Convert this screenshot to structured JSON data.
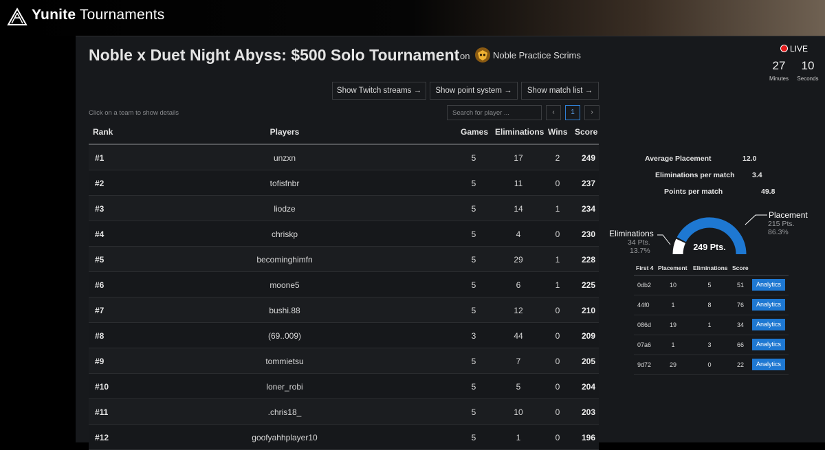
{
  "header": {
    "brand_bold": "Yunite",
    "brand_rest": " Tournaments"
  },
  "tournament": {
    "title": "Noble x Duet Night Abyss: $500 Solo Tournament",
    "on_text": "on",
    "org_name": "Noble Practice Scrims"
  },
  "live": {
    "label": "LIVE",
    "minutes": "27",
    "minutes_label": "Minutes",
    "seconds": "10",
    "seconds_label": "Seconds"
  },
  "toolbar": {
    "twitch": "Show Twitch streams",
    "points": "Show point system",
    "matches": "Show match list"
  },
  "hint": "Click on a team to show details",
  "search": {
    "placeholder": "Search for player ..."
  },
  "pagination": {
    "prev": "‹",
    "current": "1",
    "next": "›"
  },
  "table": {
    "headers": {
      "rank": "Rank",
      "players": "Players",
      "games": "Games",
      "elims": "Eliminations",
      "wins": "Wins",
      "score": "Score"
    },
    "rows": [
      {
        "rank": "#1",
        "player": "unzxn",
        "games": "5",
        "elims": "17",
        "wins": "2",
        "score": "249"
      },
      {
        "rank": "#2",
        "player": "tofisfnbr",
        "games": "5",
        "elims": "11",
        "wins": "0",
        "score": "237"
      },
      {
        "rank": "#3",
        "player": "liodze",
        "games": "5",
        "elims": "14",
        "wins": "1",
        "score": "234"
      },
      {
        "rank": "#4",
        "player": "chriskp",
        "games": "5",
        "elims": "4",
        "wins": "0",
        "score": "230"
      },
      {
        "rank": "#5",
        "player": "becominghimfn",
        "games": "5",
        "elims": "29",
        "wins": "1",
        "score": "228"
      },
      {
        "rank": "#6",
        "player": "moone5",
        "games": "5",
        "elims": "6",
        "wins": "1",
        "score": "225"
      },
      {
        "rank": "#7",
        "player": "bushi.88",
        "games": "5",
        "elims": "12",
        "wins": "0",
        "score": "210"
      },
      {
        "rank": "#8",
        "player": "(69..009)",
        "games": "3",
        "elims": "44",
        "wins": "0",
        "score": "209"
      },
      {
        "rank": "#9",
        "player": "tommietsu",
        "games": "5",
        "elims": "7",
        "wins": "0",
        "score": "205"
      },
      {
        "rank": "#10",
        "player": "loner_robi",
        "games": "5",
        "elims": "5",
        "wins": "0",
        "score": "204"
      },
      {
        "rank": "#11",
        "player": ".chris18_",
        "games": "5",
        "elims": "10",
        "wins": "0",
        "score": "203"
      },
      {
        "rank": "#12",
        "player": "goofyahhplayer10",
        "games": "5",
        "elims": "1",
        "wins": "0",
        "score": "196"
      }
    ]
  },
  "details": {
    "avg_placement_label": "Average Placement",
    "avg_placement": "12.0",
    "elims_per_match_label": "Eliminations per match",
    "elims_per_match": "3.4",
    "points_per_match_label": "Points per match",
    "points_per_match": "49.8",
    "total": "249 Pts.",
    "placement": {
      "label": "Placement",
      "pts": "215 Pts.",
      "pct": "86.3%",
      "fraction": 0.863,
      "color": "#1e78d2"
    },
    "elims": {
      "label": "Eliminations",
      "pts": "34 Pts.",
      "pct": "13.7%",
      "fraction": 0.137,
      "color": "#ffffff"
    },
    "first4": {
      "headers": {
        "id": "First 4",
        "placement": "Placement",
        "elims": "Eliminations",
        "score": "Score"
      },
      "button": "Analytics",
      "rows": [
        {
          "id": "0db2",
          "placement": "10",
          "elims": "5",
          "score": "51"
        },
        {
          "id": "44f0",
          "placement": "1",
          "elims": "8",
          "score": "76"
        },
        {
          "id": "086d",
          "placement": "19",
          "elims": "1",
          "score": "34"
        },
        {
          "id": "07a6",
          "placement": "1",
          "elims": "3",
          "score": "66"
        },
        {
          "id": "9d72",
          "placement": "29",
          "elims": "0",
          "score": "22"
        }
      ]
    }
  }
}
